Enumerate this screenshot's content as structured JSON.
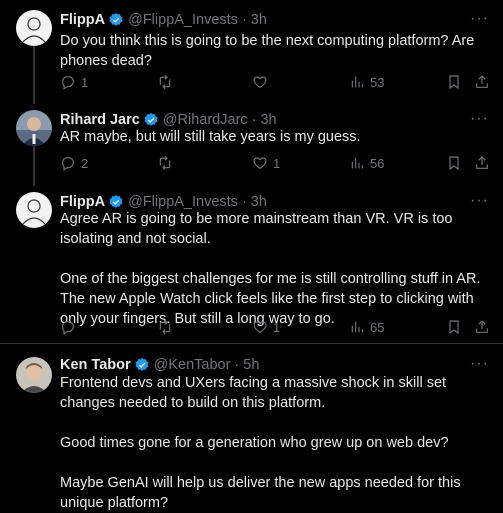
{
  "tweets": [
    {
      "name": "FlippA",
      "handle": "@FlippA_Invests",
      "time": "3h",
      "text": "Do you think this is going to be the next computing platform? Are phones dead?",
      "replies": "1",
      "retweets": "",
      "likes": "",
      "views": "53"
    },
    {
      "name": "Rihard Jarc",
      "handle": "@RihardJarc",
      "time": "3h",
      "text": "AR maybe, but will still take years is my guess.",
      "replies": "2",
      "retweets": "",
      "likes": "1",
      "views": "56"
    },
    {
      "name": "FlippA",
      "handle": "@FlippA_Invests",
      "time": "3h",
      "text": "Agree AR is going to be more mainstream than VR. VR is too isolating and not social.\n\nOne of the biggest challenges for me is still controlling stuff in AR. The new Apple Watch click feels like the first step to clicking with only your fingers. But still a long way to go.",
      "replies": "",
      "retweets": "",
      "likes": "1",
      "views": "65"
    },
    {
      "name": "Ken Tabor",
      "handle": "@KenTabor",
      "time": "5h",
      "text": "Frontend devs and UXers facing a massive shock in skill set changes needed to build on this platform.\n\nGood times gone for a generation who grew up on web dev?\n\nMaybe GenAI will help us deliver the new apps needed for this unique platform?"
    }
  ],
  "separator": "·",
  "more_icon": "more-icon",
  "colors": {
    "background": "#000000",
    "text": "#e7e9ea",
    "secondary": "#71767b",
    "verified": "#1d9bf0",
    "divider": "#2f3336"
  }
}
